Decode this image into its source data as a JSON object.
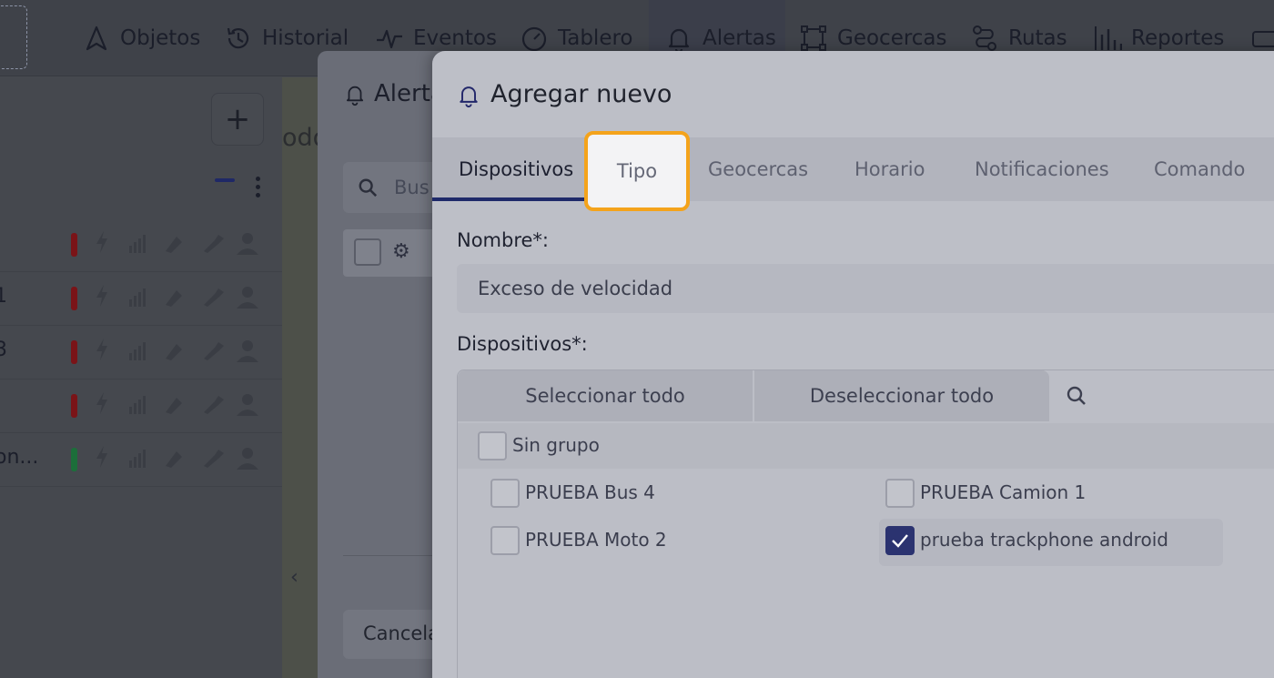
{
  "nav": {
    "items": [
      {
        "label": "Objetos",
        "icon": "navigation-arrow-icon"
      },
      {
        "label": "Historial",
        "icon": "history-icon"
      },
      {
        "label": "Eventos",
        "icon": "pulse-icon"
      },
      {
        "label": "Tablero",
        "icon": "gauge-icon"
      },
      {
        "label": "Alertas",
        "icon": "bell-icon"
      },
      {
        "label": "Geocercas",
        "icon": "geofence-icon"
      },
      {
        "label": "Rutas",
        "icon": "route-icon"
      },
      {
        "label": "Reportes",
        "icon": "bar-chart-icon"
      }
    ]
  },
  "left_panel": {
    "plus_label": "+",
    "rows": [
      {
        "label": "",
        "status_color": "#7a1418"
      },
      {
        "label": "1",
        "status_color": "#7a1418"
      },
      {
        "label": "3",
        "status_color": "#7a1418"
      },
      {
        "label": "",
        "status_color": "#7a1418"
      },
      {
        "label": "on...",
        "status_color": "#1c6e3a"
      }
    ]
  },
  "map": {
    "visible_text": "odó"
  },
  "back_dialog": {
    "title": "Alerta",
    "search_placeholder": "Bus",
    "cancel_label": "Cancela"
  },
  "dialog": {
    "title": "Agregar nuevo",
    "tabs": [
      "Dispositivos",
      "Tipo",
      "Geocercas",
      "Horario",
      "Notificaciones",
      "Comando"
    ],
    "active_tab": "Dispositivos",
    "highlighted_tab": "Tipo",
    "name_label": "Nombre*:",
    "name_value": "Exceso de velocidad",
    "devices_label": "Dispositivos*:",
    "select_all": "Seleccionar todo",
    "deselect_all": "Deseleccionar todo",
    "group": {
      "label": "Sin grupo",
      "checked": false
    },
    "devices": [
      {
        "label": "PRUEBA Bus 4",
        "checked": false
      },
      {
        "label": "PRUEBA Camion 1",
        "checked": false
      },
      {
        "label": "PRUEBA Moto 2",
        "checked": false
      },
      {
        "label": "prueba trackphone android",
        "checked": true
      }
    ]
  },
  "colors": {
    "accent": "#2b3370",
    "highlight": "#f4a31b"
  }
}
